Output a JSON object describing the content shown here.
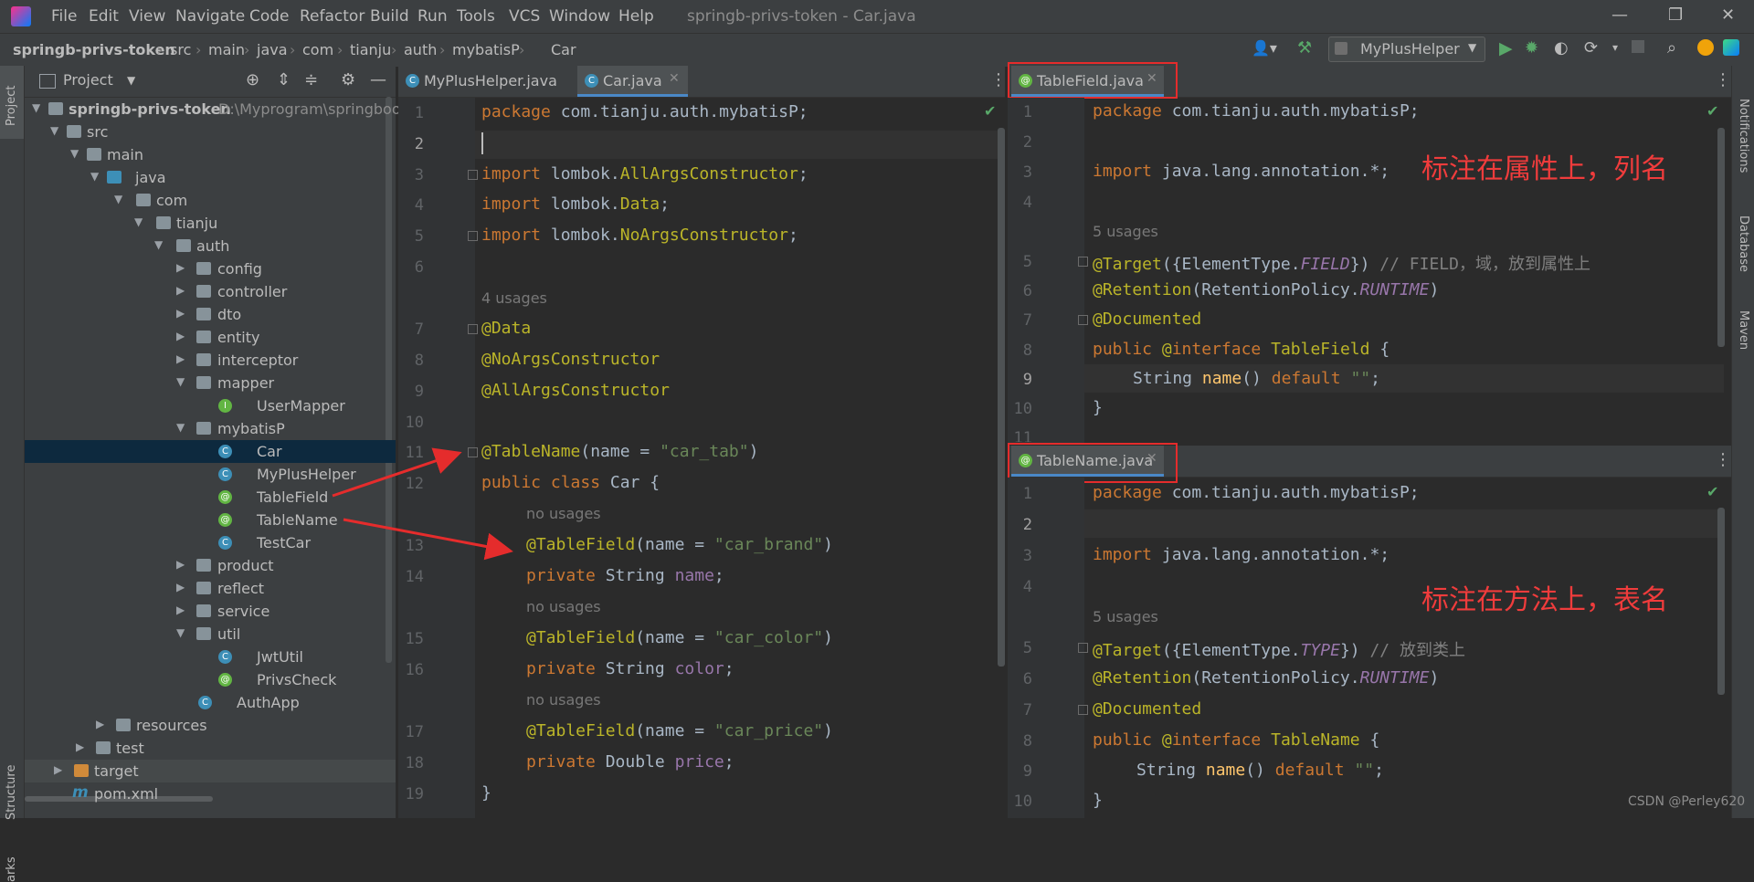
{
  "window": {
    "title": "springb-privs-token - Car.java",
    "menu": [
      "File",
      "Edit",
      "View",
      "Navigate",
      "Code",
      "Refactor",
      "Build",
      "Run",
      "Tools",
      "VCS",
      "Window",
      "Help"
    ]
  },
  "breadcrumb": [
    "springb-privs-token",
    "src",
    "main",
    "java",
    "com",
    "tianju",
    "auth",
    "mybatisP",
    "Car"
  ],
  "run_config": "MyPlusHelper",
  "left_strip": {
    "project": "Project",
    "structure": "Structure",
    "bookmarks": "arks"
  },
  "right_strip": {
    "notifications": "Notifications",
    "database": "Database",
    "maven": "Maven"
  },
  "project_panel": {
    "title": "Project",
    "rows": [
      {
        "label": "springb-privs-token",
        "extra": "D:\\Myprogram\\springboot"
      },
      {
        "label": "src"
      },
      {
        "label": "main"
      },
      {
        "label": "java"
      },
      {
        "label": "com"
      },
      {
        "label": "tianju"
      },
      {
        "label": "auth"
      },
      {
        "label": "config"
      },
      {
        "label": "controller"
      },
      {
        "label": "dto"
      },
      {
        "label": "entity"
      },
      {
        "label": "interceptor"
      },
      {
        "label": "mapper"
      },
      {
        "label": "UserMapper"
      },
      {
        "label": "mybatisP"
      },
      {
        "label": "Car"
      },
      {
        "label": "MyPlusHelper"
      },
      {
        "label": "TableField"
      },
      {
        "label": "TableName"
      },
      {
        "label": "TestCar"
      },
      {
        "label": "product"
      },
      {
        "label": "reflect"
      },
      {
        "label": "service"
      },
      {
        "label": "util"
      },
      {
        "label": "JwtUtil"
      },
      {
        "label": "PrivsCheck"
      },
      {
        "label": "AuthApp"
      },
      {
        "label": "resources"
      },
      {
        "label": "test"
      },
      {
        "label": "target"
      },
      {
        "label": "pom.xml"
      }
    ]
  },
  "editor_left": {
    "tabs": [
      "MyPlusHelper.java",
      "Car.java"
    ],
    "line_numbers": [
      "1",
      "2",
      "3",
      "4",
      "5",
      "6",
      "7",
      "8",
      "9",
      "10",
      "11",
      "12",
      "13",
      "14",
      "15",
      "16",
      "17",
      "18",
      "19"
    ],
    "hints": {
      "usages4": "4 usages",
      "no_usages": "no usages"
    }
  },
  "editor_right_top": {
    "tab": "TableField.java",
    "line_numbers": [
      "1",
      "2",
      "3",
      "4",
      "5",
      "6",
      "7",
      "8",
      "9",
      "10",
      "11"
    ],
    "hint": "5 usages",
    "annotation_note": "标注在属性上，列名"
  },
  "editor_right_bottom": {
    "tab": "TableName.java",
    "line_numbers": [
      "1",
      "2",
      "3",
      "4",
      "5",
      "6",
      "7",
      "8",
      "9",
      "10"
    ],
    "hint": "5 usages",
    "annotation_note": "标注在方法上，表名"
  },
  "watermark": "CSDN @Perley620"
}
